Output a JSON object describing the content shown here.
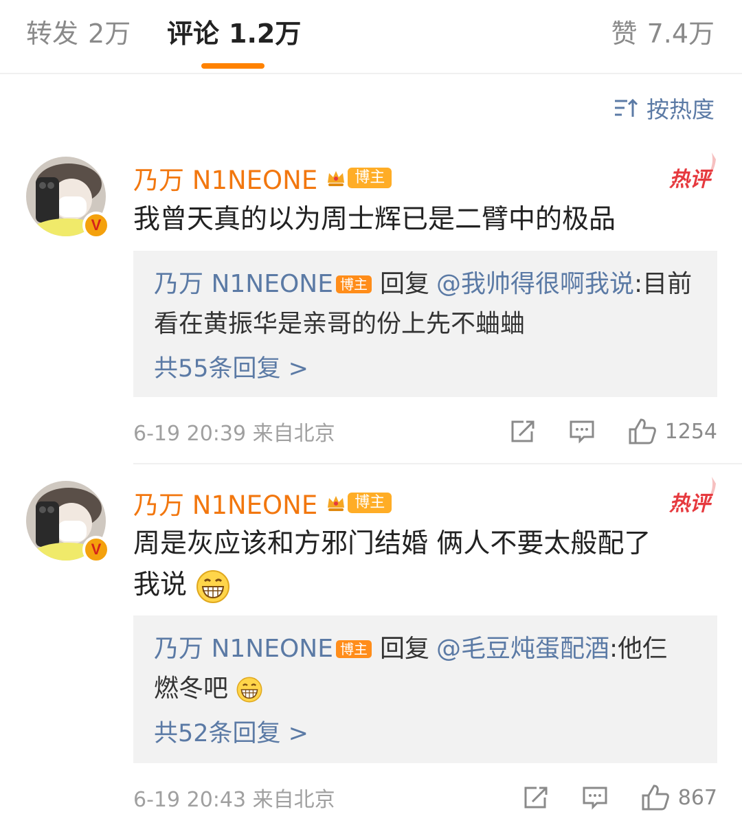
{
  "tabs": {
    "repost_label": "转发",
    "repost_count": "2万",
    "comment_label": "评论",
    "comment_count": "1.2万",
    "like_label": "赞",
    "like_count": "7.4万"
  },
  "sort": {
    "label": "按热度",
    "icon": "sort-icon"
  },
  "comments": [
    {
      "author": "乃万 N1NEONE",
      "author_tag": "博主",
      "hot_label": "热评",
      "text": "我曾天真的以为周士辉已是二臂中的极品",
      "reply": {
        "author": "乃万 N1NEONE",
        "author_tag": "博主",
        "reply_word": "回复",
        "mention": "@我帅得很啊我说",
        "text": ":目前看在黄振华是亲哥的份上先不蛐蛐",
        "total": "共55条回复 >"
      },
      "time": "6-19 20:39",
      "location": "来自北京",
      "likes": "1254"
    },
    {
      "author": "乃万 N1NEONE",
      "author_tag": "博主",
      "hot_label": "热评",
      "text_line1": "周是灰应该和方邪门结婚 俩人不要太般配了",
      "text_line2": "我说",
      "reply": {
        "author": "乃万 N1NEONE",
        "author_tag": "博主",
        "reply_word": "回复",
        "mention": "@毛豆炖蛋配酒",
        "text_line1": ":他仨",
        "text_line2": "燃冬吧",
        "total": "共52条回复 >"
      },
      "time": "6-19 20:43",
      "location": "来自北京",
      "likes": "867"
    }
  ],
  "colors": {
    "accent": "#ff8200",
    "author": "#f2770f",
    "link": "#5b7aa5",
    "hot": "#e6393e",
    "reply_bg": "#f2f2f2"
  }
}
